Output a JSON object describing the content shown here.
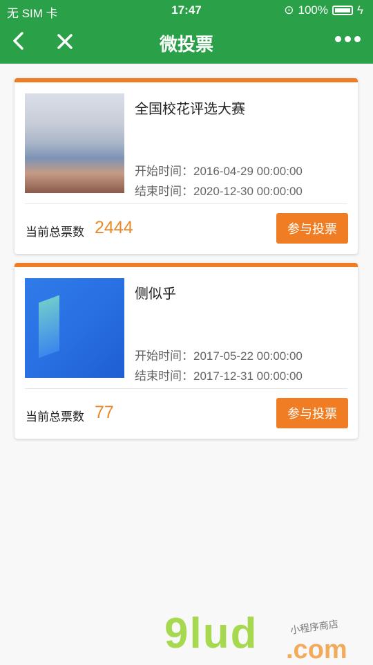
{
  "status": {
    "carrier": "无 SIM 卡",
    "time": "17:47",
    "battery": "100%"
  },
  "nav": {
    "title": "微投票"
  },
  "polls": [
    {
      "name": "全国校花评选大赛",
      "start_label": "开始时间：",
      "start": "2016-04-29 00:00:00",
      "end_label": "结束时间：",
      "end": "2020-12-30 00:00:00",
      "votes_label": "当前总票数",
      "votes": "2444",
      "button": "参与投票"
    },
    {
      "name": "侧似乎",
      "start_label": "开始时间：",
      "start": "2017-05-22 00:00:00",
      "end_label": "结束时间：",
      "end": "2017-12-31 00:00:00",
      "votes_label": "当前总票数",
      "votes": "77",
      "button": "参与投票"
    }
  ],
  "watermark": {
    "brand": "9lud",
    "domain": ".com",
    "tagline": "小程序商店"
  },
  "colors": {
    "header": "#2aa148",
    "accent": "#f07d24",
    "count": "#e88a2a"
  }
}
